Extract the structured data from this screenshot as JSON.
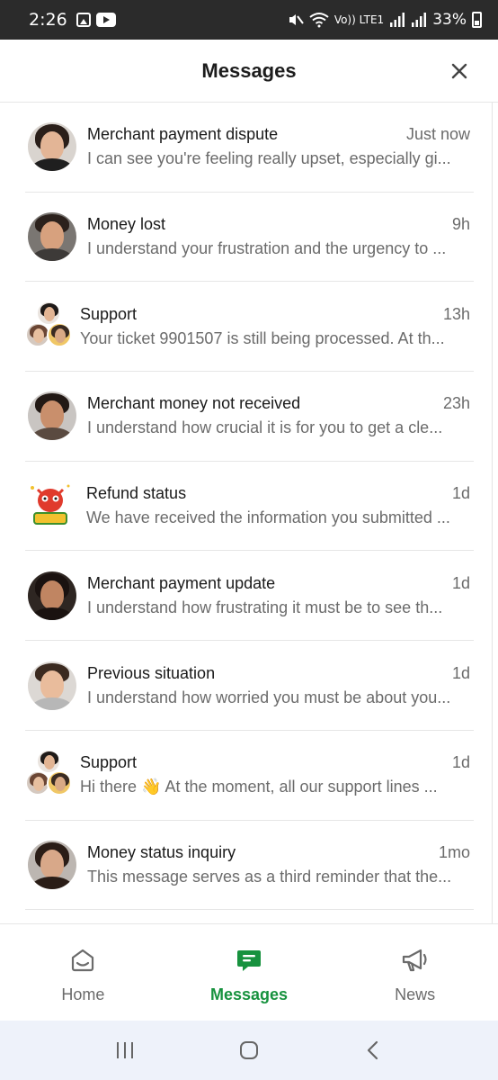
{
  "status_bar": {
    "time": "2:26",
    "network_label": "Vo)) LTE1",
    "battery": "33%"
  },
  "header": {
    "title": "Messages",
    "close_icon": "close-icon"
  },
  "messages": [
    {
      "title": "Merchant payment dispute",
      "time": "Just now",
      "preview": "I can see you're feeling really upset, especially gi...",
      "avatar": "woman-portrait"
    },
    {
      "title": "Money lost",
      "time": "9h",
      "preview": "I understand your frustration and the urgency to ...",
      "avatar": "man-portrait"
    },
    {
      "title": "Support",
      "time": "13h",
      "preview": "Your ticket 9901507 is still being processed. At th...",
      "avatar": "group-avatar"
    },
    {
      "title": "Merchant money not received",
      "time": "23h",
      "preview": "I understand how crucial it is for you to get a cle...",
      "avatar": "man-portrait"
    },
    {
      "title": "Refund status",
      "time": "1d",
      "preview": "We have received the information you submitted ...",
      "avatar": "mascot"
    },
    {
      "title": "Merchant payment update",
      "time": "1d",
      "preview": "I understand how frustrating it must be to see th...",
      "avatar": "woman-portrait"
    },
    {
      "title": "Previous situation",
      "time": "1d",
      "preview": "I understand how worried you must be about you...",
      "avatar": "man-portrait"
    },
    {
      "title": "Support",
      "time": "1d",
      "preview": "Hi there 👋   At the moment, all our support lines ...",
      "avatar": "group-avatar"
    },
    {
      "title": "Money status inquiry",
      "time": "1mo",
      "preview": "This message serves as a third reminder that the...",
      "avatar": "woman-portrait"
    }
  ],
  "bottom_nav": [
    {
      "label": "Home",
      "icon": "home-icon",
      "active": false
    },
    {
      "label": "Messages",
      "icon": "chat-icon",
      "active": true
    },
    {
      "label": "News",
      "icon": "megaphone-icon",
      "active": false
    }
  ],
  "colors": {
    "accent": "#17923e",
    "status_bar": "#2b2b2b",
    "system_nav": "#eef2fa"
  }
}
